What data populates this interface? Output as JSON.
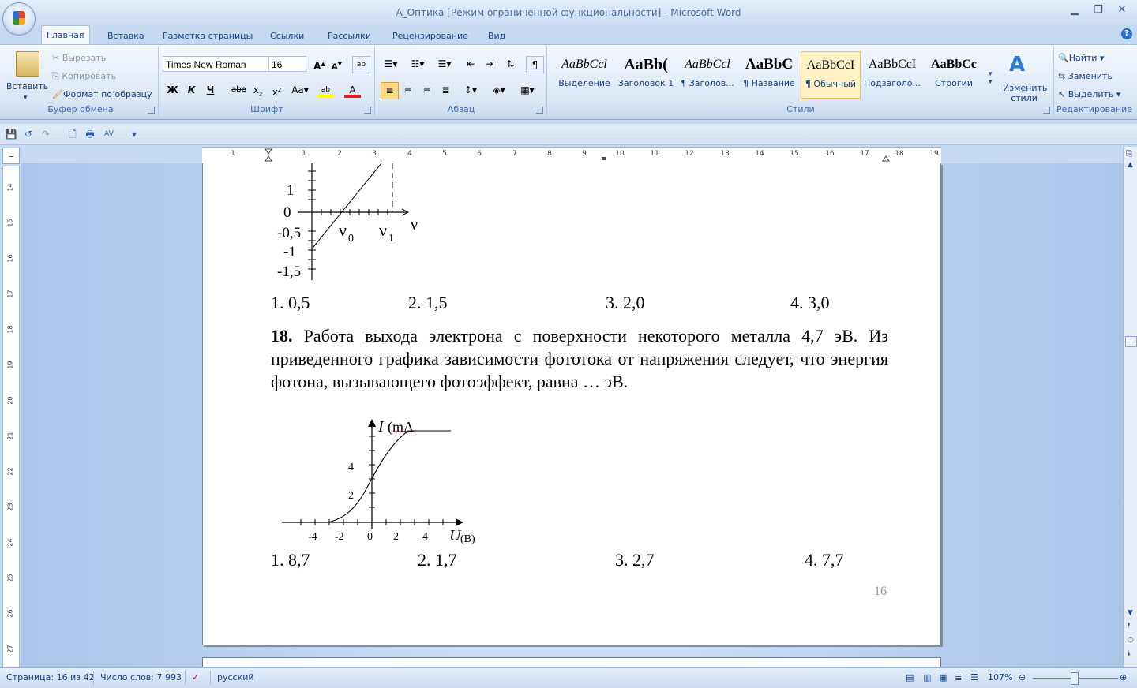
{
  "window": {
    "title": "А_Оптика [Режим ограниченной функциональности] - Microsoft Word"
  },
  "tabs": [
    "Главная",
    "Вставка",
    "Разметка страницы",
    "Ссылки",
    "Рассылки",
    "Рецензирование",
    "Вид"
  ],
  "clipboard": {
    "paste": "Вставить",
    "cut": "Вырезать",
    "copy": "Копировать",
    "format_painter": "Формат по образцу",
    "label": "Буфер обмена"
  },
  "font": {
    "name": "Times New Roman",
    "size": "16",
    "label": "Шрифт"
  },
  "paragraph": {
    "label": "Абзац"
  },
  "styles": {
    "label": "Стили",
    "change": "Изменить стили",
    "items": [
      {
        "sample": "AaBbCcl",
        "name": "Выделение"
      },
      {
        "sample": "AaBb(",
        "name": "Заголовок 1"
      },
      {
        "sample": "AaBbCcl",
        "name": "¶ Заголов..."
      },
      {
        "sample": "AaBbC",
        "name": "¶ Название"
      },
      {
        "sample": "AaBbCcI",
        "name": "¶ Обычный"
      },
      {
        "sample": "AaBbCcI",
        "name": "Подзаголо..."
      },
      {
        "sample": "AaBbCc",
        "name": "Строгий"
      }
    ]
  },
  "editing": {
    "find": "Найти",
    "replace": "Заменить",
    "select": "Выделить",
    "label": "Редактирование"
  },
  "ruler": {
    "h": [
      "1",
      "1",
      "2",
      "3",
      "4",
      "5",
      "6",
      "7",
      "8",
      "9",
      "10",
      "11",
      "12",
      "13",
      "14",
      "15",
      "16",
      "17",
      "18",
      "19"
    ],
    "v": [
      "14",
      "15",
      "16",
      "17",
      "18",
      "19",
      "20",
      "21",
      "22",
      "23",
      "24",
      "25",
      "26",
      "27"
    ]
  },
  "graph1": {
    "y_ticks": [
      "1",
      "0",
      "-0,5",
      "-1",
      "-1,5"
    ],
    "x_labels": [
      "ν",
      "0",
      "ν",
      "1",
      "ν"
    ]
  },
  "q17_answers": [
    "1. 0,5",
    "2. 1,5",
    "3. 2,0",
    "4. 3,0"
  ],
  "q18": {
    "num": "18.",
    "text": " Работа выхода электрона с поверхности некоторого металла 4,7 эВ. Из приведенного графика зависимости фототока от напряжения следует, что энергия фотона, вызывающего фотоэффект, равна … эВ."
  },
  "graph2": {
    "y_label": "I",
    "y_unit": "(mA",
    "y_ticks": [
      "4",
      "2"
    ],
    "x_ticks": [
      "-4",
      "-2",
      "0",
      "2",
      "4"
    ],
    "x_label": "U",
    "x_unit": "(B)"
  },
  "q18_answers": [
    "1. 8,7",
    "2. 1,7",
    "3. 2,7",
    "4. 7,7"
  ],
  "page_number": "16",
  "status": {
    "page": "Страница: 16 из 42",
    "words": "Число слов: 7 993",
    "lang": "русский",
    "zoom": "107%"
  }
}
